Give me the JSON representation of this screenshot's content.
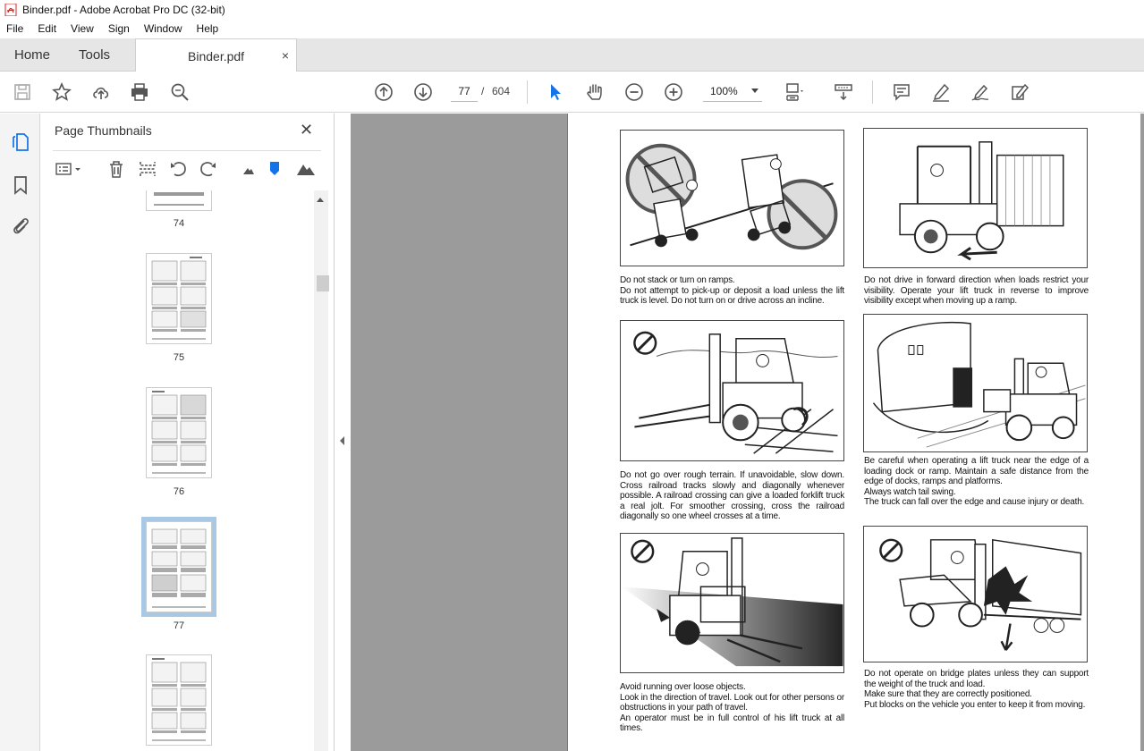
{
  "window": {
    "title": "Binder.pdf - Adobe Acrobat Pro DC (32-bit)"
  },
  "menu": [
    "File",
    "Edit",
    "View",
    "Sign",
    "Window",
    "Help"
  ],
  "tabs": {
    "home": "Home",
    "tools": "Tools",
    "document": "Binder.pdf",
    "close_glyph": "×"
  },
  "toolbar": {
    "current_page": "77",
    "separator": "/",
    "total_pages": "604",
    "zoom": "100%"
  },
  "panel": {
    "title": "Page Thumbnails",
    "close_glyph": "✕",
    "thumbnails": [
      {
        "label": "74"
      },
      {
        "label": "75"
      },
      {
        "label": "76"
      },
      {
        "label": "77",
        "selected": true
      },
      {
        "label": ""
      }
    ]
  },
  "page": {
    "captions": {
      "c1": [
        "Do not stack or turn on ramps.",
        "Do not attempt to pick-up or deposit a load unless the lift truck is level. Do not turn on or drive across an incline."
      ],
      "c2": [
        "Do not drive in forward direction when loads restrict your visibility. Operate your lift truck in reverse to improve visibility except when moving up a ramp."
      ],
      "c3": [
        "Do not go over rough terrain. If unavoidable, slow down. Cross railroad tracks slowly and diagonally whenever possible. A railroad crossing can give a loaded forklift truck a real jolt. For smoother crossing, cross the railroad diagonally so one wheel crosses at a time."
      ],
      "c4": [
        "Be careful when operating a lift truck near the edge of a loading dock or ramp. Maintain a safe distance from the edge of docks, ramps and platforms.",
        "Always watch tail swing.",
        "The truck can fall over the edge and cause injury or death."
      ],
      "c5": [
        "Avoid running over loose objects.",
        "Look in the direction of travel. Look out for other persons or obstructions in your path of travel.",
        "An operator must be in full control of his lift truck at all times."
      ],
      "c6": [
        "Do not operate on bridge plates unless they can support the weight of the truck and load.",
        "Make sure that they are correctly positioned.",
        "Put blocks on the vehicle you enter to keep it from moving."
      ]
    }
  },
  "icons": {
    "save": "save-icon",
    "bookmark": "star-icon",
    "upload": "upload-icon",
    "print": "print-icon",
    "find": "zoom-search-icon",
    "prev": "arrow-up-circle-icon",
    "next": "arrow-down-circle-icon",
    "select": "cursor-arrow-icon",
    "hand": "hand-icon",
    "zoom_out": "zoom-out-icon",
    "zoom_in": "zoom-in-icon",
    "fit": "fit-page-icon",
    "scroll": "scroll-mode-icon",
    "comment": "comment-icon",
    "highlight": "highlight-pen-icon",
    "sign": "sign-icon",
    "edit": "edit-document-icon"
  },
  "colors": {
    "accent": "#1473e6",
    "selected_thumb": "#a8c8e4"
  }
}
